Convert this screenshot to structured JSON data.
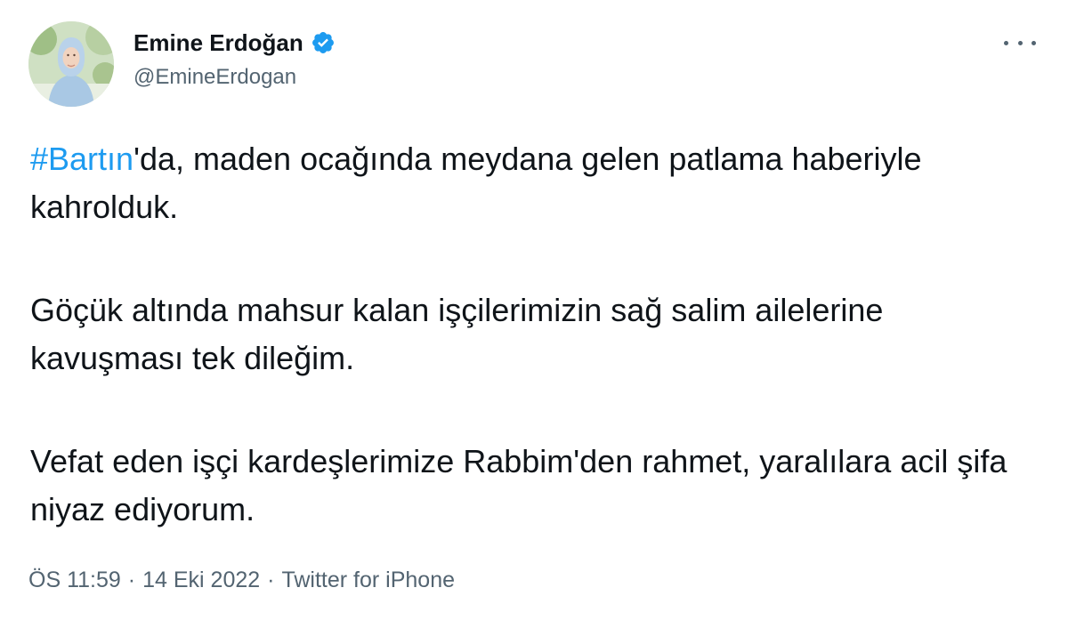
{
  "author": {
    "display_name": "Emine Erdoğan",
    "handle": "@EmineErdogan",
    "verified_icon": "verified-badge-icon",
    "avatar_icon": "profile-photo"
  },
  "more_icon": "ellipsis-icon",
  "tweet": {
    "hashtag": "#Bartın",
    "para1_rest": "'da, maden ocağında meydana gelen patlama haberiyle kahrolduk.",
    "para2": "Göçük altında mahsur kalan işçilerimizin sağ salim ailelerine kavuşması tek dileğim.",
    "para3": "Vefat eden işçi kardeşlerimize Rabbim'den rahmet, yaralılara acil şifa niyaz ediyorum."
  },
  "meta": {
    "time": "ÖS 11:59",
    "separator": "·",
    "date": "14 Eki 2022",
    "source": "Twitter for iPhone"
  },
  "colors": {
    "link": "#1d9bf0",
    "text": "#0f1419",
    "secondary": "#536471"
  }
}
